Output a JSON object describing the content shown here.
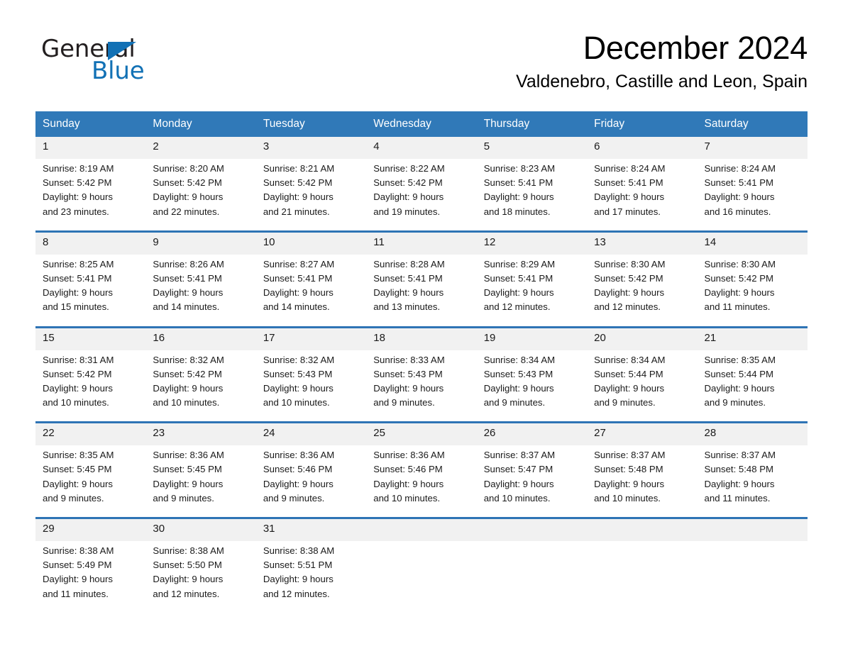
{
  "brand": {
    "name_part1": "General",
    "name_part2": "Blue",
    "triangle_color": "#1271b5",
    "accent_color": "#2e74b5"
  },
  "header": {
    "title": "December 2024",
    "subtitle": "Valdenebro, Castille and Leon, Spain"
  },
  "calendar": {
    "header_bg": "#3079b8",
    "header_text_color": "#ffffff",
    "daynum_bg": "#f1f1f1",
    "weekdays": [
      "Sunday",
      "Monday",
      "Tuesday",
      "Wednesday",
      "Thursday",
      "Friday",
      "Saturday"
    ],
    "weeks": [
      [
        {
          "day": "1",
          "sunrise": "Sunrise: 8:19 AM",
          "sunset": "Sunset: 5:42 PM",
          "daylight_line1": "Daylight: 9 hours",
          "daylight_line2": "and 23 minutes."
        },
        {
          "day": "2",
          "sunrise": "Sunrise: 8:20 AM",
          "sunset": "Sunset: 5:42 PM",
          "daylight_line1": "Daylight: 9 hours",
          "daylight_line2": "and 22 minutes."
        },
        {
          "day": "3",
          "sunrise": "Sunrise: 8:21 AM",
          "sunset": "Sunset: 5:42 PM",
          "daylight_line1": "Daylight: 9 hours",
          "daylight_line2": "and 21 minutes."
        },
        {
          "day": "4",
          "sunrise": "Sunrise: 8:22 AM",
          "sunset": "Sunset: 5:42 PM",
          "daylight_line1": "Daylight: 9 hours",
          "daylight_line2": "and 19 minutes."
        },
        {
          "day": "5",
          "sunrise": "Sunrise: 8:23 AM",
          "sunset": "Sunset: 5:41 PM",
          "daylight_line1": "Daylight: 9 hours",
          "daylight_line2": "and 18 minutes."
        },
        {
          "day": "6",
          "sunrise": "Sunrise: 8:24 AM",
          "sunset": "Sunset: 5:41 PM",
          "daylight_line1": "Daylight: 9 hours",
          "daylight_line2": "and 17 minutes."
        },
        {
          "day": "7",
          "sunrise": "Sunrise: 8:24 AM",
          "sunset": "Sunset: 5:41 PM",
          "daylight_line1": "Daylight: 9 hours",
          "daylight_line2": "and 16 minutes."
        }
      ],
      [
        {
          "day": "8",
          "sunrise": "Sunrise: 8:25 AM",
          "sunset": "Sunset: 5:41 PM",
          "daylight_line1": "Daylight: 9 hours",
          "daylight_line2": "and 15 minutes."
        },
        {
          "day": "9",
          "sunrise": "Sunrise: 8:26 AM",
          "sunset": "Sunset: 5:41 PM",
          "daylight_line1": "Daylight: 9 hours",
          "daylight_line2": "and 14 minutes."
        },
        {
          "day": "10",
          "sunrise": "Sunrise: 8:27 AM",
          "sunset": "Sunset: 5:41 PM",
          "daylight_line1": "Daylight: 9 hours",
          "daylight_line2": "and 14 minutes."
        },
        {
          "day": "11",
          "sunrise": "Sunrise: 8:28 AM",
          "sunset": "Sunset: 5:41 PM",
          "daylight_line1": "Daylight: 9 hours",
          "daylight_line2": "and 13 minutes."
        },
        {
          "day": "12",
          "sunrise": "Sunrise: 8:29 AM",
          "sunset": "Sunset: 5:41 PM",
          "daylight_line1": "Daylight: 9 hours",
          "daylight_line2": "and 12 minutes."
        },
        {
          "day": "13",
          "sunrise": "Sunrise: 8:30 AM",
          "sunset": "Sunset: 5:42 PM",
          "daylight_line1": "Daylight: 9 hours",
          "daylight_line2": "and 12 minutes."
        },
        {
          "day": "14",
          "sunrise": "Sunrise: 8:30 AM",
          "sunset": "Sunset: 5:42 PM",
          "daylight_line1": "Daylight: 9 hours",
          "daylight_line2": "and 11 minutes."
        }
      ],
      [
        {
          "day": "15",
          "sunrise": "Sunrise: 8:31 AM",
          "sunset": "Sunset: 5:42 PM",
          "daylight_line1": "Daylight: 9 hours",
          "daylight_line2": "and 10 minutes."
        },
        {
          "day": "16",
          "sunrise": "Sunrise: 8:32 AM",
          "sunset": "Sunset: 5:42 PM",
          "daylight_line1": "Daylight: 9 hours",
          "daylight_line2": "and 10 minutes."
        },
        {
          "day": "17",
          "sunrise": "Sunrise: 8:32 AM",
          "sunset": "Sunset: 5:43 PM",
          "daylight_line1": "Daylight: 9 hours",
          "daylight_line2": "and 10 minutes."
        },
        {
          "day": "18",
          "sunrise": "Sunrise: 8:33 AM",
          "sunset": "Sunset: 5:43 PM",
          "daylight_line1": "Daylight: 9 hours",
          "daylight_line2": "and 9 minutes."
        },
        {
          "day": "19",
          "sunrise": "Sunrise: 8:34 AM",
          "sunset": "Sunset: 5:43 PM",
          "daylight_line1": "Daylight: 9 hours",
          "daylight_line2": "and 9 minutes."
        },
        {
          "day": "20",
          "sunrise": "Sunrise: 8:34 AM",
          "sunset": "Sunset: 5:44 PM",
          "daylight_line1": "Daylight: 9 hours",
          "daylight_line2": "and 9 minutes."
        },
        {
          "day": "21",
          "sunrise": "Sunrise: 8:35 AM",
          "sunset": "Sunset: 5:44 PM",
          "daylight_line1": "Daylight: 9 hours",
          "daylight_line2": "and 9 minutes."
        }
      ],
      [
        {
          "day": "22",
          "sunrise": "Sunrise: 8:35 AM",
          "sunset": "Sunset: 5:45 PM",
          "daylight_line1": "Daylight: 9 hours",
          "daylight_line2": "and 9 minutes."
        },
        {
          "day": "23",
          "sunrise": "Sunrise: 8:36 AM",
          "sunset": "Sunset: 5:45 PM",
          "daylight_line1": "Daylight: 9 hours",
          "daylight_line2": "and 9 minutes."
        },
        {
          "day": "24",
          "sunrise": "Sunrise: 8:36 AM",
          "sunset": "Sunset: 5:46 PM",
          "daylight_line1": "Daylight: 9 hours",
          "daylight_line2": "and 9 minutes."
        },
        {
          "day": "25",
          "sunrise": "Sunrise: 8:36 AM",
          "sunset": "Sunset: 5:46 PM",
          "daylight_line1": "Daylight: 9 hours",
          "daylight_line2": "and 10 minutes."
        },
        {
          "day": "26",
          "sunrise": "Sunrise: 8:37 AM",
          "sunset": "Sunset: 5:47 PM",
          "daylight_line1": "Daylight: 9 hours",
          "daylight_line2": "and 10 minutes."
        },
        {
          "day": "27",
          "sunrise": "Sunrise: 8:37 AM",
          "sunset": "Sunset: 5:48 PM",
          "daylight_line1": "Daylight: 9 hours",
          "daylight_line2": "and 10 minutes."
        },
        {
          "day": "28",
          "sunrise": "Sunrise: 8:37 AM",
          "sunset": "Sunset: 5:48 PM",
          "daylight_line1": "Daylight: 9 hours",
          "daylight_line2": "and 11 minutes."
        }
      ],
      [
        {
          "day": "29",
          "sunrise": "Sunrise: 8:38 AM",
          "sunset": "Sunset: 5:49 PM",
          "daylight_line1": "Daylight: 9 hours",
          "daylight_line2": "and 11 minutes."
        },
        {
          "day": "30",
          "sunrise": "Sunrise: 8:38 AM",
          "sunset": "Sunset: 5:50 PM",
          "daylight_line1": "Daylight: 9 hours",
          "daylight_line2": "and 12 minutes."
        },
        {
          "day": "31",
          "sunrise": "Sunrise: 8:38 AM",
          "sunset": "Sunset: 5:51 PM",
          "daylight_line1": "Daylight: 9 hours",
          "daylight_line2": "and 12 minutes."
        },
        {
          "day": "",
          "sunrise": "",
          "sunset": "",
          "daylight_line1": "",
          "daylight_line2": ""
        },
        {
          "day": "",
          "sunrise": "",
          "sunset": "",
          "daylight_line1": "",
          "daylight_line2": ""
        },
        {
          "day": "",
          "sunrise": "",
          "sunset": "",
          "daylight_line1": "",
          "daylight_line2": ""
        },
        {
          "day": "",
          "sunrise": "",
          "sunset": "",
          "daylight_line1": "",
          "daylight_line2": ""
        }
      ]
    ]
  }
}
